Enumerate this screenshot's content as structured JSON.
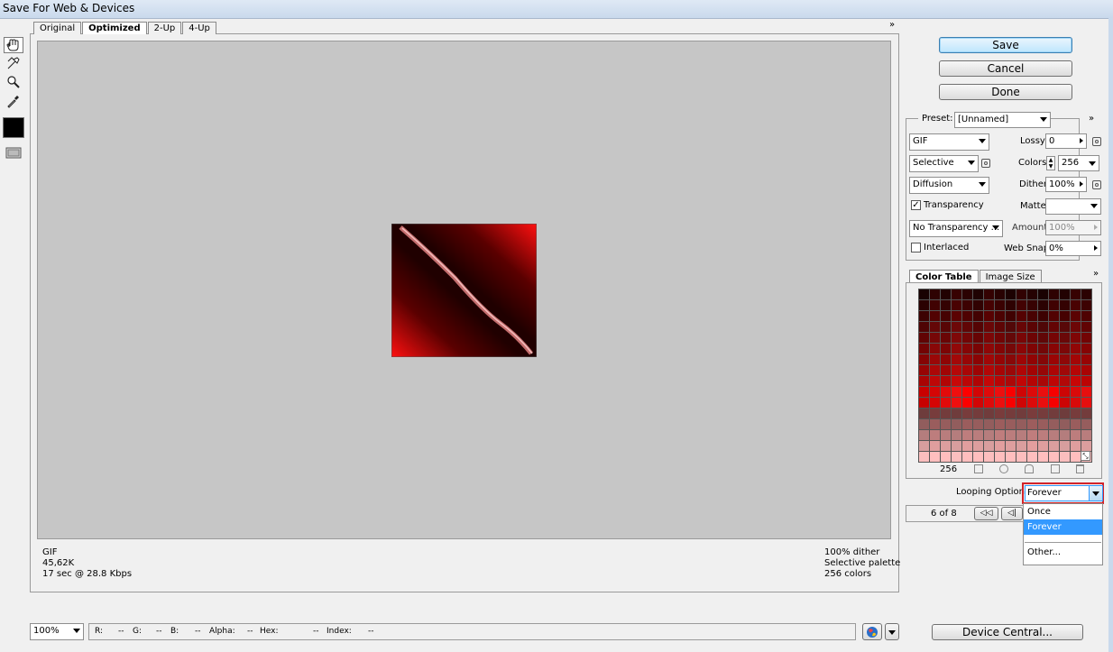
{
  "window": {
    "title": "Save For Web & Devices"
  },
  "tabs": [
    {
      "label": "Original",
      "active": false
    },
    {
      "label": "Optimized",
      "active": true
    },
    {
      "label": "2-Up",
      "active": false
    },
    {
      "label": "4-Up",
      "active": false
    }
  ],
  "tools": [
    "hand-tool-icon",
    "slice-select-tool-icon",
    "zoom-tool-icon",
    "eyedropper-tool-icon",
    "eyedropper-color-swatch",
    "toggle-slices-visibility-icon"
  ],
  "canvas_info": {
    "left_lines": [
      "GIF",
      "45,62K",
      "17 sec @ 28.8 Kbps"
    ],
    "right_lines": [
      "100% dither",
      "Selective palette",
      "256 colors"
    ]
  },
  "buttons": {
    "save": "Save",
    "cancel": "Cancel",
    "done": "Done",
    "device_central": "Device Central..."
  },
  "settings": {
    "preset_label": "Preset:",
    "preset_value": "[Unnamed]",
    "format": "GIF",
    "reduction": "Selective",
    "dither_algorithm": "Diffusion",
    "transparency_label": "Transparency",
    "transparency_checked": true,
    "transparency_dither": "No Transparency ...",
    "interlaced_label": "Interlaced",
    "interlaced_checked": false,
    "lossy_label": "Lossy:",
    "lossy_value": "0",
    "colors_label": "Colors:",
    "colors_value": "256",
    "dither_label": "Dither:",
    "dither_value": "100%",
    "matte_label": "Matte:",
    "matte_value": "",
    "amount_label": "Amount:",
    "amount_value": "100%",
    "websnap_label": "Web Snap:",
    "websnap_value": "0%"
  },
  "color_panel": {
    "tabs": [
      "Color Table",
      "Image Size"
    ],
    "active_tab": "Color Table",
    "color_count": "256",
    "footer_icons": [
      "map-to-transparent-icon",
      "web-shift-icon",
      "lock-color-icon",
      "new-color-icon",
      "delete-color-icon"
    ]
  },
  "looping": {
    "label": "Looping Options:",
    "value": "Forever",
    "options": [
      "Once",
      "Forever",
      "",
      "Other..."
    ],
    "highlighted": "Forever"
  },
  "animation": {
    "frame_counter": "6 of 8"
  },
  "statusbar": {
    "zoom": "100%",
    "r_label": "R:",
    "r_value": "--",
    "g_label": "G:",
    "g_value": "--",
    "b_label": "B:",
    "b_value": "--",
    "alpha_label": "Alpha:",
    "alpha_value": "--",
    "hex_label": "Hex:",
    "hex_value": "--",
    "index_label": "Index:",
    "index_value": "--"
  },
  "colors": {
    "accent": "#3399ff",
    "highlight_border": "#d2232a",
    "canvas_bg": "#c6c6c6"
  }
}
